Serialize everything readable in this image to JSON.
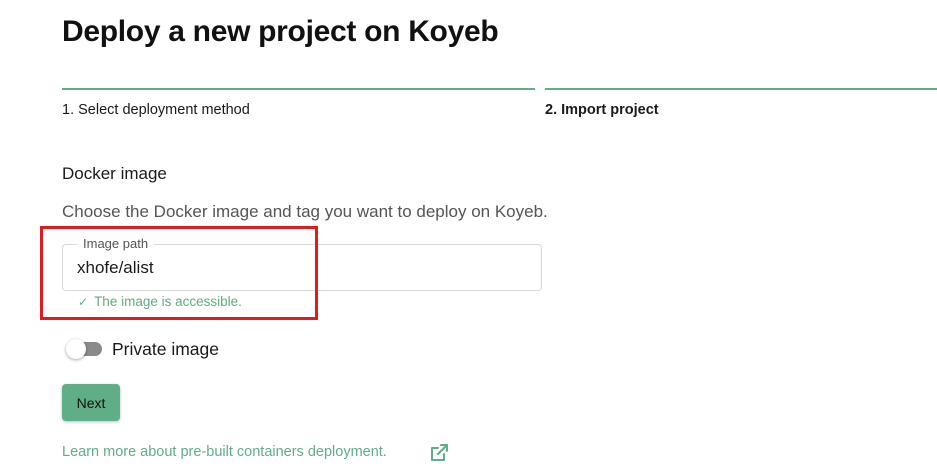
{
  "page": {
    "title": "Deploy a new project on Koyeb"
  },
  "steps": [
    {
      "label": "1. Select deployment method"
    },
    {
      "label": "2. Import project"
    }
  ],
  "docker": {
    "section_title": "Docker image",
    "description": "Choose the Docker image and tag you want to deploy on Koyeb.",
    "image_path_label": "Image path",
    "image_path_value": "xhofe/alist",
    "helper_check": "✓",
    "helper_text": "The image is accessible."
  },
  "private_image": {
    "label": "Private image",
    "enabled": false
  },
  "actions": {
    "next_label": "Next"
  },
  "footer": {
    "learn_more_text": "Learn more about pre-built containers deployment.",
    "external_icon": "external-link-icon"
  },
  "colors": {
    "accent": "#5fae87",
    "highlight": "#e01b1b",
    "toggle_off": "#8a8a8a"
  }
}
